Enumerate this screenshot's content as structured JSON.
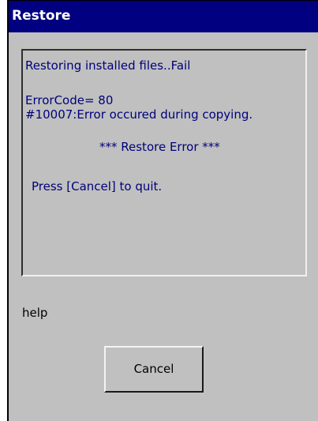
{
  "window": {
    "title": "Restore"
  },
  "log": {
    "lines": [
      "Restoring installed files..Fail",
      "ErrorCode= 80",
      "#10007:Error occured during copying.",
      "*** Restore Error ***",
      "Press [Cancel] to quit."
    ]
  },
  "help": {
    "text": "help"
  },
  "buttons": {
    "cancel_label": "Cancel"
  },
  "colors": {
    "titlebar": "#000080",
    "title_text": "#ffffff",
    "window_face": "#c0c0c0",
    "log_text": "#00007a"
  }
}
